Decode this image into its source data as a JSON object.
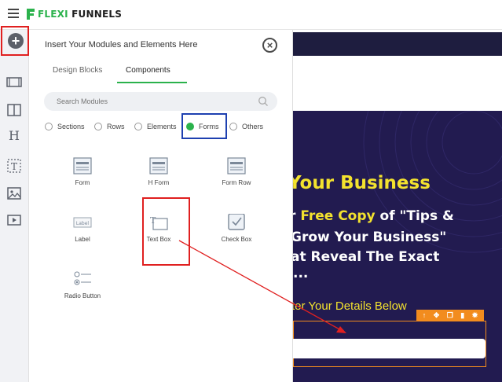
{
  "app": {
    "logo_prefix": "FLEXI",
    "logo_suffix": "FUNNELS"
  },
  "rail": {
    "items": [
      {
        "icon": "add-icon"
      },
      {
        "icon": "section-icon"
      },
      {
        "icon": "columns-icon"
      },
      {
        "icon": "heading-icon"
      },
      {
        "icon": "text-icon"
      },
      {
        "icon": "image-icon"
      },
      {
        "icon": "video-icon"
      }
    ]
  },
  "panel": {
    "title": "Insert Your Modules and Elements Here",
    "tabs": [
      {
        "label": "Design Blocks",
        "active": false
      },
      {
        "label": "Components",
        "active": true
      }
    ],
    "search_placeholder": "Search Modules",
    "filters": [
      {
        "label": "Sections",
        "checked": false
      },
      {
        "label": "Rows",
        "checked": false
      },
      {
        "label": "Elements",
        "checked": false
      },
      {
        "label": "Forms",
        "checked": true
      },
      {
        "label": "Others",
        "checked": false
      }
    ],
    "components": [
      {
        "label": "Form",
        "icon": "form-icon"
      },
      {
        "label": "H Form",
        "icon": "horizontal-form-icon"
      },
      {
        "label": "Form Row",
        "icon": "form-row-icon"
      },
      {
        "label": "Label",
        "icon": "label-icon",
        "icon_text": "Label"
      },
      {
        "label": "Text Box",
        "icon": "text-box-icon",
        "icon_text": "T"
      },
      {
        "label": "Check Box",
        "icon": "check-box-icon"
      },
      {
        "label": "Radio Button",
        "icon": "radio-button-icon"
      }
    ]
  },
  "preview": {
    "headline": "Your Business",
    "line1_prefix": "r ",
    "line1_highlight": "Free Copy",
    "line1_suffix": " of \"Tips &",
    "line2": " Grow Your Business\"",
    "line3": "at Reveal The Exact",
    "line4": "...",
    "enter_details": "ter Your Details Below",
    "toolbar_icons": [
      "arrow-up-icon",
      "move-icon",
      "copy-icon",
      "trash-icon",
      "gear-icon"
    ]
  },
  "colors": {
    "accent_green": "#2bb24c",
    "hero_bg": "#221b50",
    "hero_yellow": "#f3e22e",
    "orange": "#f28c1e",
    "highlight_red": "#e02020",
    "highlight_blue": "#1e40b0"
  }
}
